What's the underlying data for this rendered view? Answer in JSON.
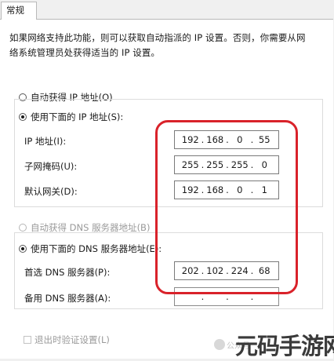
{
  "tab": {
    "label": "常规"
  },
  "description": {
    "line1": "如果网络支持此功能，则可以获取自动指派的 IP 设置。否则，你需要从网",
    "line2": "络系统管理员处获得适当的 IP 设置。"
  },
  "ip_section": {
    "auto_label": "自动获得 IP 地址(O)",
    "auto_checked": false,
    "manual_label": "使用下面的 IP 地址(S):",
    "manual_checked": true,
    "ip_label": "IP 地址(I):",
    "ip": [
      "192",
      "168",
      "0",
      "55"
    ],
    "mask_label": "子网掩码(U):",
    "mask": [
      "255",
      "255",
      "255",
      "0"
    ],
    "gateway_label": "默认网关(D):",
    "gateway": [
      "192",
      "168",
      "0",
      "1"
    ]
  },
  "dns_section": {
    "auto_label": "自动获得 DNS 服务器地址(B)",
    "auto_checked": false,
    "auto_disabled": true,
    "manual_label": "使用下面的 DNS 服务器地址(E):",
    "manual_checked": true,
    "preferred_label": "首选 DNS 服务器(P):",
    "preferred": [
      "202",
      "102",
      "224",
      "68"
    ],
    "alternate_label": "备用 DNS 服务器(A):",
    "alternate": [
      "",
      "",
      "",
      ""
    ]
  },
  "validate": {
    "label": "退出时验证设置(L)",
    "checked": false,
    "disabled": true
  },
  "ip_dot": ".",
  "watermark": {
    "small": "公众号",
    "large": "元码手游网"
  },
  "colors": {
    "highlight": "#d9222a",
    "panel": "#ffffff",
    "window": "#f0f0f0"
  }
}
